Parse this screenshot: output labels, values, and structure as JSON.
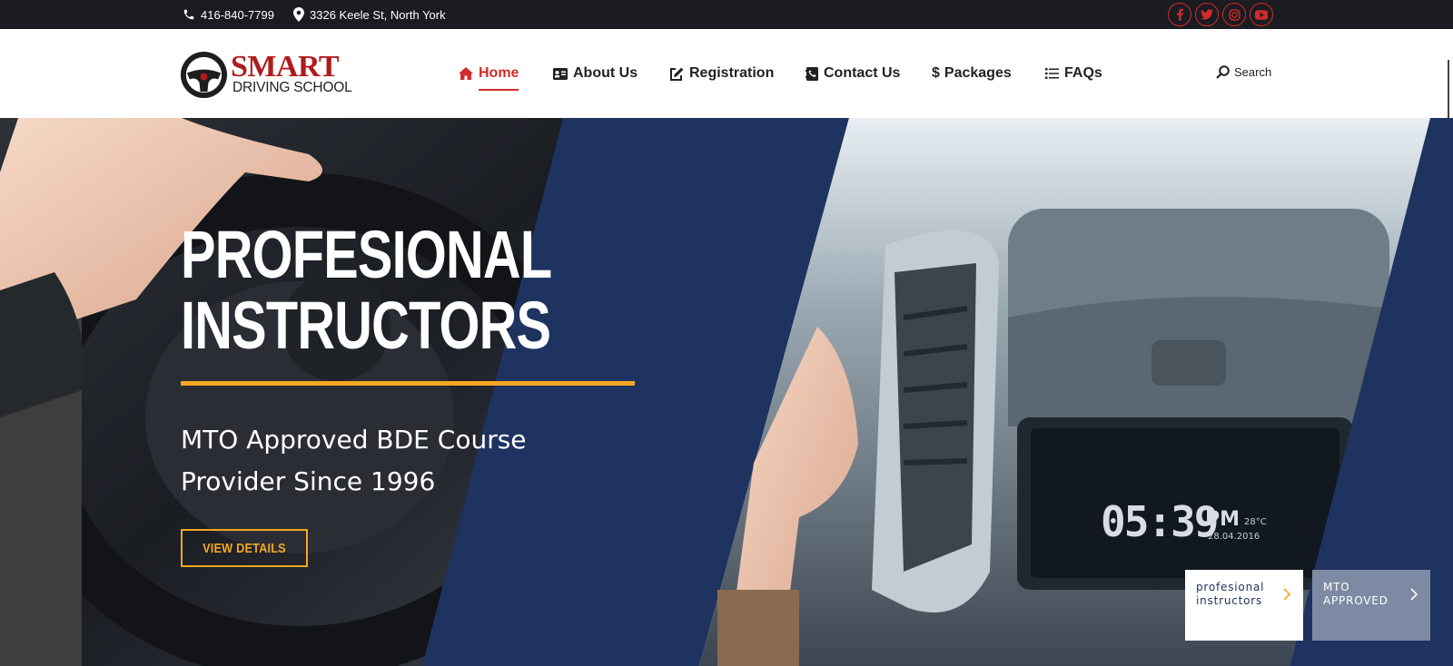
{
  "topbar": {
    "phone": "416-840-7799",
    "address": "3326 Keele St, North York",
    "social": [
      "facebook-icon",
      "twitter-icon",
      "instagram-icon",
      "youtube-icon"
    ]
  },
  "logo": {
    "brand": "SMART",
    "sub": "DRIVING SCHOOL"
  },
  "nav": {
    "items": [
      {
        "label": "Home",
        "icon": "home-icon",
        "active": true
      },
      {
        "label": "About Us",
        "icon": "id-card-icon"
      },
      {
        "label": "Registration",
        "icon": "edit-icon"
      },
      {
        "label": "Contact Us",
        "icon": "contact-book-icon"
      },
      {
        "label": "Packages",
        "icon": "dollar-icon"
      },
      {
        "label": "FAQs",
        "icon": "list-icon"
      }
    ],
    "search_label": "Search"
  },
  "hero": {
    "title_line1": "PROFESIONAL",
    "title_line2": "INSTRUCTORS",
    "subtitle_line1": "MTO Approved BDE Course",
    "subtitle_line2": "Provider Since 1996",
    "button": "VIEW DETAILS",
    "dashboard_time": "05:39",
    "dashboard_ampm": "PM",
    "dashboard_temp": "28°C",
    "dashboard_date": "28.04.2016"
  },
  "thumbnails": [
    {
      "line1": "profesional",
      "line2": "instructors"
    },
    {
      "line1": "MTO",
      "line2": "APPROVED"
    }
  ],
  "colors": {
    "accent": "#d22b2b",
    "navy": "#1e3360",
    "gold": "#f5a623",
    "topbar": "#1b1c21"
  }
}
